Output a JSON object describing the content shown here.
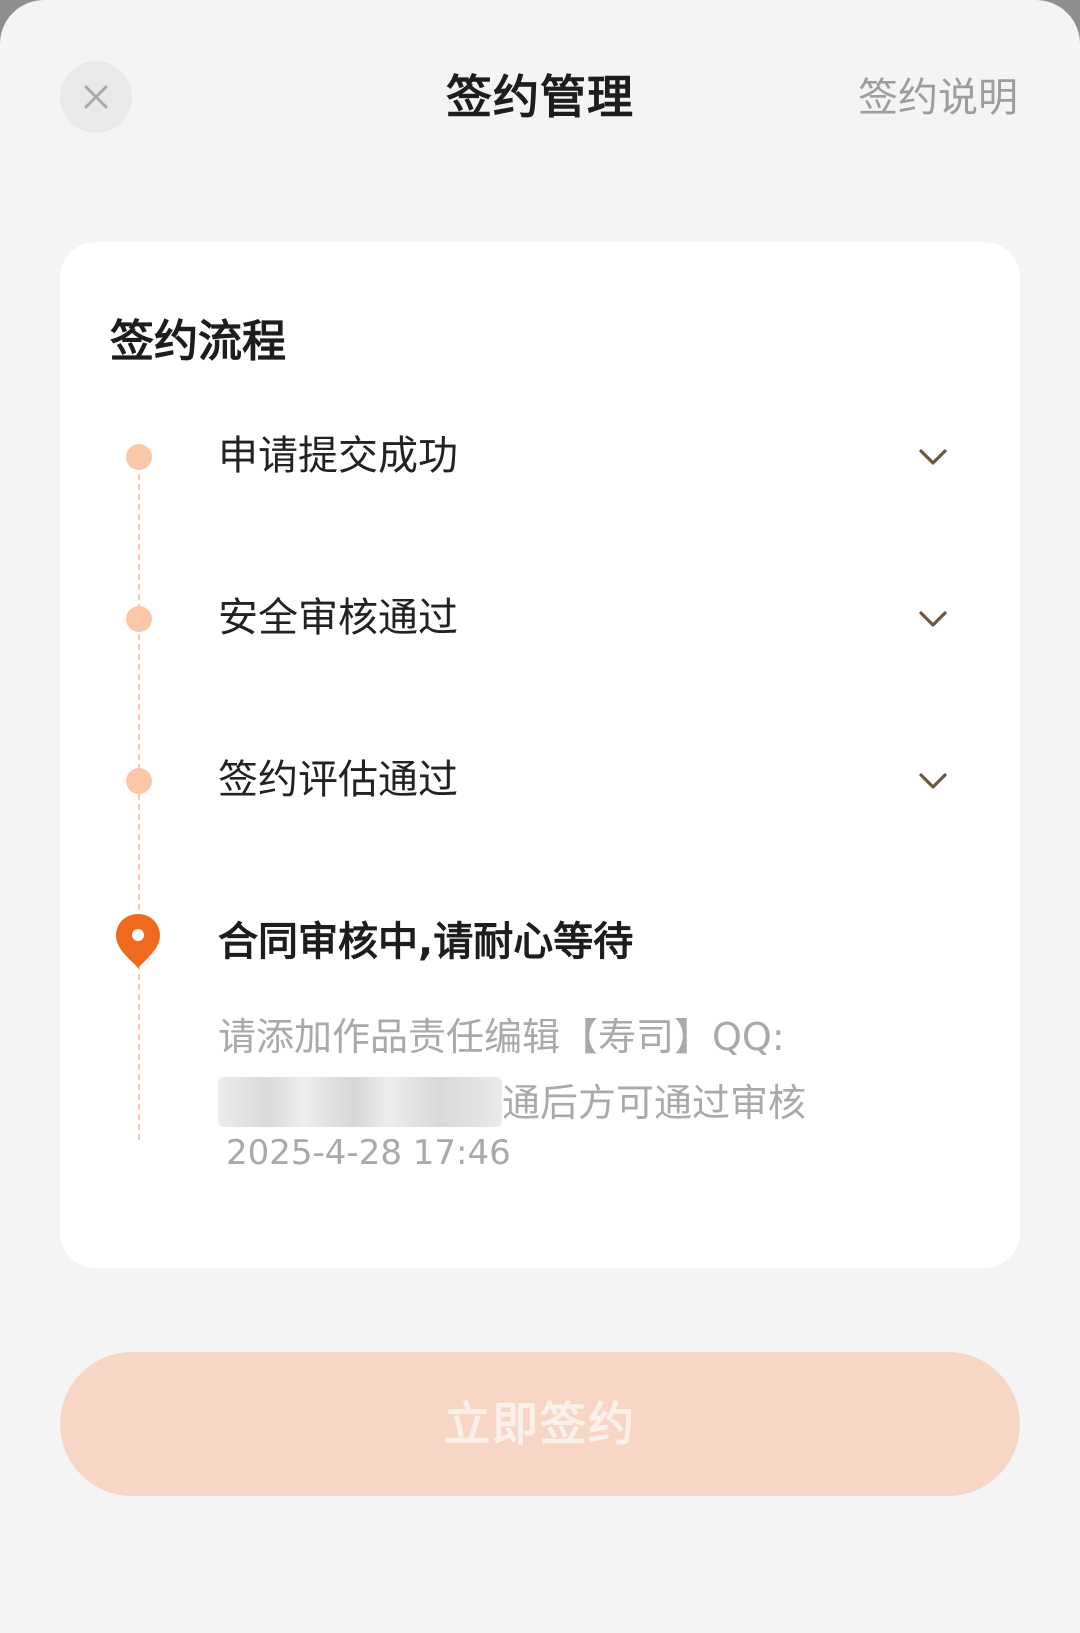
{
  "header": {
    "title": "签约管理",
    "help_link": "签约说明"
  },
  "card": {
    "title": "签约流程",
    "steps": [
      {
        "label": "申请提交成功",
        "status": "completed"
      },
      {
        "label": "安全审核通过",
        "status": "completed"
      },
      {
        "label": "签约评估通过",
        "status": "completed"
      }
    ],
    "current_step": {
      "label": "合同审核中,请耐心等待",
      "desc_line1": "请添加作品责任编辑【寿司】QQ:",
      "desc_line2_suffix": "通后方可通过审核",
      "time": "2025-4-28  17:46"
    }
  },
  "footer": {
    "sign_button": "立即签约"
  },
  "colors": {
    "accent": "#f06a1e",
    "dot": "#fac8a8",
    "button_disabled": "#f7d6c5"
  },
  "icons": {
    "close": "close-icon",
    "chevron": "chevron-down-icon",
    "pin": "location-pin-icon"
  }
}
